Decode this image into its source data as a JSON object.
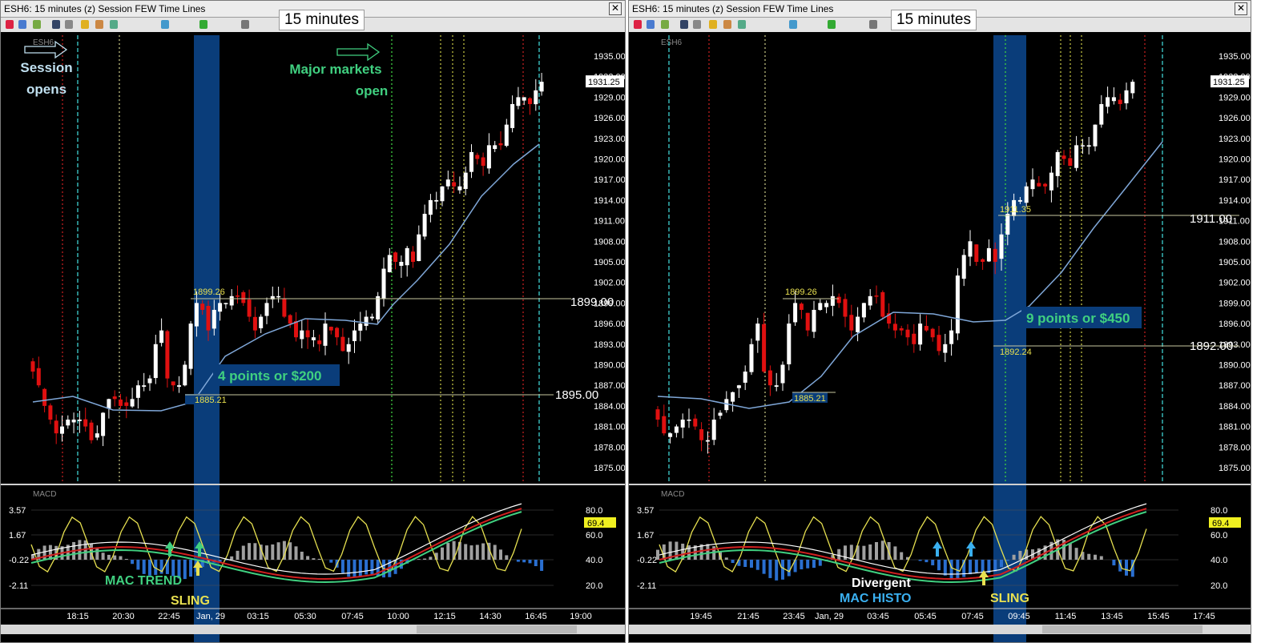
{
  "windows": [
    {
      "title": "ESH6: 15 minutes (z) Session FEW  Time Lines",
      "timeframe_label": "15 minutes",
      "close_glyph": "✕",
      "symbol_label": "ESH6"
    },
    {
      "title": "ESH6: 15 minutes (z) Session FEW  Time Lines",
      "timeframe_label": "15 minutes",
      "close_glyph": "✕",
      "symbol_label": "ESH6"
    }
  ],
  "chart_data": [
    {
      "type": "candlestick",
      "symbol": "ESH6",
      "timeframe": "15 minutes",
      "price_axis": {
        "ticks": [
          "1935.00",
          "1932.00",
          "1929.00",
          "1926.00",
          "1923.00",
          "1920.00",
          "1917.00",
          "1914.00",
          "1911.00",
          "1908.00",
          "1905.00",
          "1902.00",
          "1899.00",
          "1896.00",
          "1893.00",
          "1890.00",
          "1887.00",
          "1884.00",
          "1881.00",
          "1878.00",
          "1875.00"
        ],
        "range": [
          1873,
          1937
        ]
      },
      "last_price": "1931.25",
      "time_axis": {
        "ticks": [
          "18:15",
          "20:30",
          "22:45",
          "Jan, 29",
          "03:15",
          "05:30",
          "07:45",
          "10:00",
          "12:15",
          "14:30",
          "16:45",
          "19:00"
        ]
      },
      "closes": [
        1889,
        1887,
        1884,
        1882,
        1880,
        1881,
        1882,
        1882,
        1882,
        1881,
        1879,
        1880,
        1883,
        1885,
        1885,
        1884,
        1884,
        1885,
        1887,
        1887,
        1888,
        1893,
        1895,
        1888,
        1887,
        1887,
        1890,
        1896,
        1899,
        1898,
        1895,
        1898,
        1899,
        1899,
        1900,
        1900,
        1899,
        1897,
        1895,
        1897,
        1899,
        1900,
        1900,
        1897,
        1896,
        1894,
        1895,
        1894,
        1894,
        1893,
        1896,
        1895,
        1894,
        1892,
        1893,
        1895,
        1896,
        1897,
        1897,
        1900,
        1904,
        1906,
        1905,
        1905,
        1907,
        1905,
        1909,
        1912,
        1914,
        1914,
        1916,
        1917,
        1916,
        1916,
        1918,
        1921,
        1920,
        1919,
        1922,
        1922,
        1922,
        1925,
        1928,
        1929,
        1929,
        1928,
        1930,
        1931.25
      ],
      "annotations": [
        {
          "type": "arrow",
          "text": "Session opens",
          "x": "18:15"
        },
        {
          "type": "arrow",
          "text": "Major markets open",
          "x": "10:00"
        },
        {
          "type": "level",
          "text": "1899.26",
          "value": 1899.26
        },
        {
          "type": "level",
          "text": "1885.21",
          "value": 1885.21
        },
        {
          "type": "level",
          "text": "1899.00",
          "value": 1899.0
        },
        {
          "type": "level",
          "text": "1895.00",
          "value": 1895.0
        },
        {
          "type": "note",
          "text": "4 points or $200"
        }
      ],
      "macd_panel": {
        "title": "MACD",
        "left_ticks": [
          "3.57",
          "1.67",
          "-0.22",
          "-2.11"
        ],
        "right_ticks": [
          "80.0",
          "60.0",
          "40.0",
          "20.0"
        ],
        "stoch_value": "69.4",
        "labels": [
          "MAC TREND",
          "SLING"
        ]
      }
    },
    {
      "type": "candlestick",
      "symbol": "ESH6",
      "timeframe": "15 minutes",
      "price_axis": {
        "ticks": [
          "1935.00",
          "1932.00",
          "1929.00",
          "1926.00",
          "1923.00",
          "1920.00",
          "1917.00",
          "1914.00",
          "1911.00",
          "1908.00",
          "1905.00",
          "1902.00",
          "1899.00",
          "1896.00",
          "1893.00",
          "1890.00",
          "1887.00",
          "1884.00",
          "1881.00",
          "1878.00",
          "1875.00"
        ],
        "range": [
          1873,
          1937
        ]
      },
      "last_price": "1931.25",
      "time_axis": {
        "ticks": [
          "19:45",
          "21:45",
          "23:45",
          "Jan, 29",
          "03:45",
          "05:45",
          "07:45",
          "09:45",
          "11:45",
          "13:45",
          "15:45",
          "17:45"
        ]
      },
      "closes": [
        1882,
        1880,
        1880,
        1881,
        1882,
        1882,
        1881,
        1879,
        1879,
        1882,
        1883,
        1885,
        1886,
        1887,
        1889,
        1893,
        1896,
        1889,
        1887,
        1887,
        1890,
        1896,
        1899,
        1898,
        1895,
        1898,
        1899,
        1899,
        1900,
        1899,
        1897,
        1895,
        1897,
        1899,
        1900,
        1900,
        1897,
        1896,
        1895,
        1895,
        1894,
        1893,
        1896,
        1895,
        1894,
        1892,
        1893,
        1895,
        1903,
        1906,
        1908,
        1905,
        1905,
        1907,
        1905,
        1909,
        1912,
        1914,
        1914,
        1916,
        1917,
        1916,
        1916,
        1918,
        1921,
        1920,
        1919,
        1922,
        1922,
        1922,
        1925,
        1928,
        1929,
        1929,
        1928,
        1930,
        1931.25
      ],
      "annotations": [
        {
          "type": "level",
          "text": "1899.26",
          "value": 1899.26
        },
        {
          "type": "level",
          "text": "1885.21",
          "value": 1885.21
        },
        {
          "type": "level",
          "text": "1911.35",
          "value": 1911.35
        },
        {
          "type": "level",
          "text": "1892.24",
          "value": 1892.24
        },
        {
          "type": "level",
          "text": "1911.00",
          "value": 1911.0
        },
        {
          "type": "level",
          "text": "1892.00",
          "value": 1892.0
        },
        {
          "type": "note",
          "text": "9 points or $450"
        }
      ],
      "macd_panel": {
        "title": "MACD",
        "left_ticks": [
          "3.57",
          "1.67",
          "-0.22",
          "-2.11"
        ],
        "right_ticks": [
          "80.0",
          "60.0",
          "40.0",
          "20.0"
        ],
        "stoch_value": "69.4",
        "labels": [
          "Divergent",
          "MAC HISTO",
          "SLING"
        ]
      }
    }
  ],
  "colors": {
    "up_candle": "#ffffff",
    "down_candle": "#e01010",
    "highlight_band": "#0a3d7a",
    "ema_line": "#7fa7d8",
    "session_line": "#3fd0d0",
    "major_open_line": "#3fd040",
    "macd_red": "#d02020",
    "macd_green": "#40d080",
    "stochastic": "#e6e050",
    "hist_up": "#a0a0a0",
    "hist_down": "#2a6fd0",
    "annotation_green": "#40d080",
    "annotation_blue": "#c0e0f0"
  }
}
